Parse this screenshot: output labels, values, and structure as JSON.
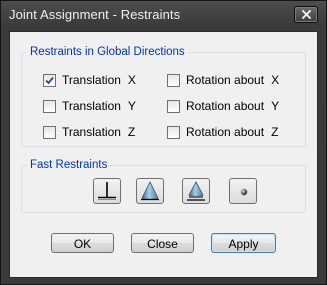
{
  "window": {
    "title": "Joint Assignment - Restraints"
  },
  "global": {
    "title": "Restraints in Global Directions",
    "items": [
      {
        "label": "Translation",
        "axis": "X",
        "checked": true
      },
      {
        "label": "Rotation about",
        "axis": "X",
        "checked": false
      },
      {
        "label": "Translation",
        "axis": "Y",
        "checked": false
      },
      {
        "label": "Rotation about",
        "axis": "Y",
        "checked": false
      },
      {
        "label": "Translation",
        "axis": "Z",
        "checked": false
      },
      {
        "label": "Rotation about",
        "axis": "Z",
        "checked": false
      }
    ]
  },
  "fast": {
    "title": "Fast Restraints",
    "tools": [
      {
        "icon": "fixed-support-icon"
      },
      {
        "icon": "pinned-support-icon"
      },
      {
        "icon": "roller-support-icon"
      },
      {
        "icon": "free-joint-icon"
      }
    ]
  },
  "buttons": {
    "ok": "OK",
    "close": "Close",
    "apply": "Apply"
  },
  "colors": {
    "group_title": "#0033bb",
    "support_blue": "#5f95b8"
  }
}
